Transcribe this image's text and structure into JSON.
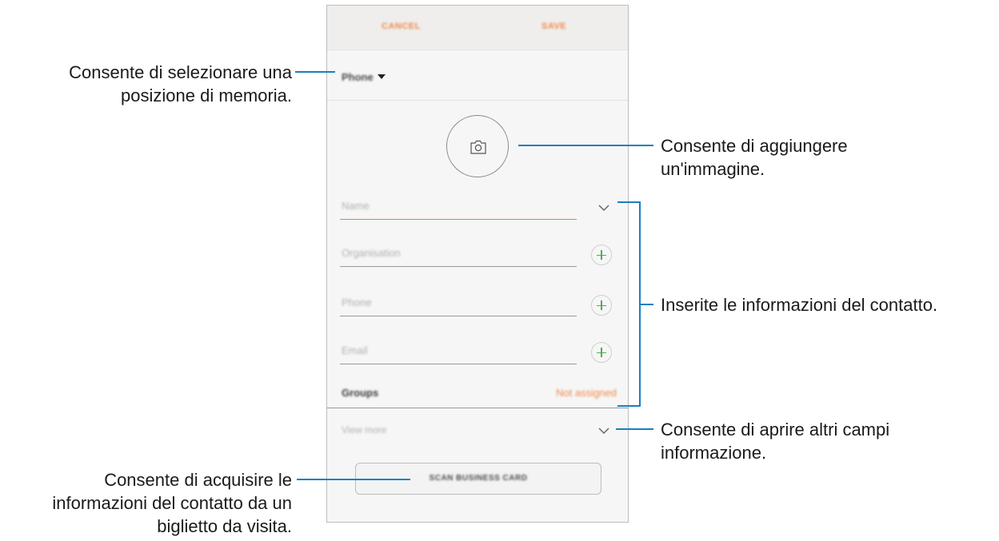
{
  "app": {
    "cancel_label": "CANCEL",
    "save_label": "SAVE",
    "storage_label": "Phone",
    "fields": [
      {
        "placeholder": "Name"
      },
      {
        "placeholder": "Organisation"
      },
      {
        "placeholder": "Phone"
      },
      {
        "placeholder": "Email"
      }
    ],
    "groups_label": "Groups",
    "groups_value": "Not assigned",
    "view_more_label": "View more",
    "scan_label": "SCAN BUSINESS CARD"
  },
  "callouts": {
    "storage": [
      "Consente di selezionare una",
      "posizione di memoria."
    ],
    "image": [
      "Consente di aggiungere",
      "un'immagine."
    ],
    "contact_info": [
      "Inserite le informazioni del contatto."
    ],
    "more_fields": [
      "Consente di aprire altri campi",
      "informazione."
    ],
    "scan": [
      "Consente di acquisire le",
      "informazioni del contatto da un",
      "biglietto da visita."
    ]
  },
  "colors": {
    "accent": "#f0894a",
    "callout_line": "#1a7fbf",
    "plus_icon": "#4caf50"
  },
  "icons": [
    "camera-icon",
    "chevron-down-icon",
    "plus-icon",
    "caret-down-icon"
  ]
}
